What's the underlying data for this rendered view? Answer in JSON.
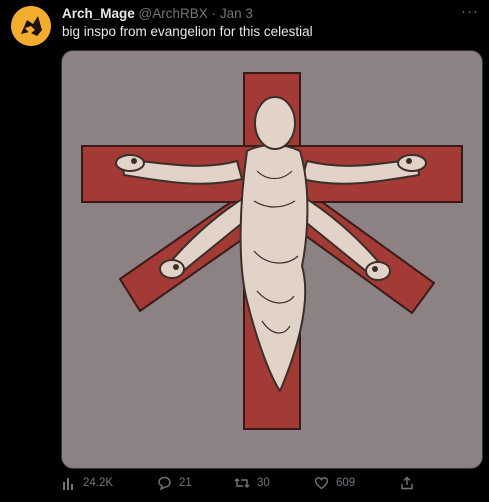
{
  "tweet": {
    "author_name": "Arch_Mage",
    "handle": "@ArchRBX",
    "separator": "·",
    "date": "Jan 3",
    "text": "big inspo from evangelion for this celestial",
    "more_label": "···",
    "media": {
      "subject": "Illustration of a pale celestial figure on a red cross",
      "background_color": "#8d8283",
      "cross_color": "#a33a35",
      "figure_color": "#e2d3c8"
    }
  },
  "actions": {
    "views": "24.2K",
    "replies": "21",
    "retweets": "30",
    "likes": "609"
  },
  "icons": {
    "views": "bar-chart-icon",
    "reply": "speech-bubble-icon",
    "retweet": "retweet-arrows-icon",
    "like": "heart-icon",
    "share": "share-arrow-icon",
    "more": "ellipsis-icon"
  },
  "colors": {
    "background": "#000000",
    "text_primary": "#e7e9ea",
    "text_secondary": "#71767b",
    "avatar_bg": "#f2ac2e"
  }
}
